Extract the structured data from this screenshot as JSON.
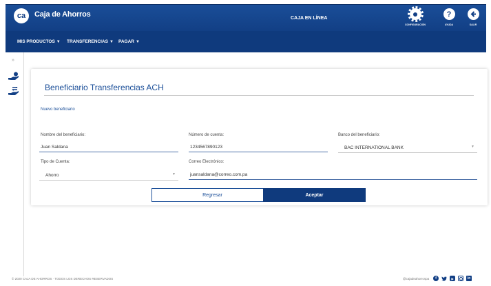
{
  "header": {
    "logo_text": "ca",
    "brand": "Caja de Ahorros",
    "center_label": "CAJA EN LÍNEA",
    "actions": [
      {
        "label": "CONFIGURACIÓN",
        "icon": "gear-icon"
      },
      {
        "label": "AYUDA",
        "icon": "help-icon"
      },
      {
        "label": "SALIR",
        "icon": "logout-icon"
      }
    ]
  },
  "menu": {
    "items": [
      {
        "label": "MIS PRODUCTOS"
      },
      {
        "label": "TRANSFERENCIAS"
      },
      {
        "label": "PAGAR"
      }
    ],
    "caret": "▼"
  },
  "sidebar": {
    "expand_glyph": "»"
  },
  "form": {
    "title": "Beneficiario Transferencias ACH",
    "subtitle": "Nuevo beneficiario",
    "fields": {
      "name": {
        "label": "Nombre del beneficiario:",
        "value": "Juan Saldana"
      },
      "account": {
        "label": "Número de cuenta:",
        "value": "1234567890123"
      },
      "bank": {
        "label": "Banco del beneficiario:",
        "value": "BAC INTERNATIONAL BANK"
      },
      "account_type": {
        "label": "Tipo de Cuenta:",
        "value": "Ahorro"
      },
      "email": {
        "label": "Correo Electrónico:",
        "value": "juansaldana@correo.com.pa"
      }
    },
    "buttons": {
      "back": "Regresar",
      "accept": "Aceptar"
    }
  },
  "footer": {
    "copyright": "© 2020 CAJA DE AHORROS · TODOS LOS DERECHOS RESERVADOS",
    "handle": "@cajadeahorrospa"
  },
  "colors": {
    "primary": "#123f85",
    "menu": "#0f3a7d",
    "accent_text": "#1a4e98"
  }
}
